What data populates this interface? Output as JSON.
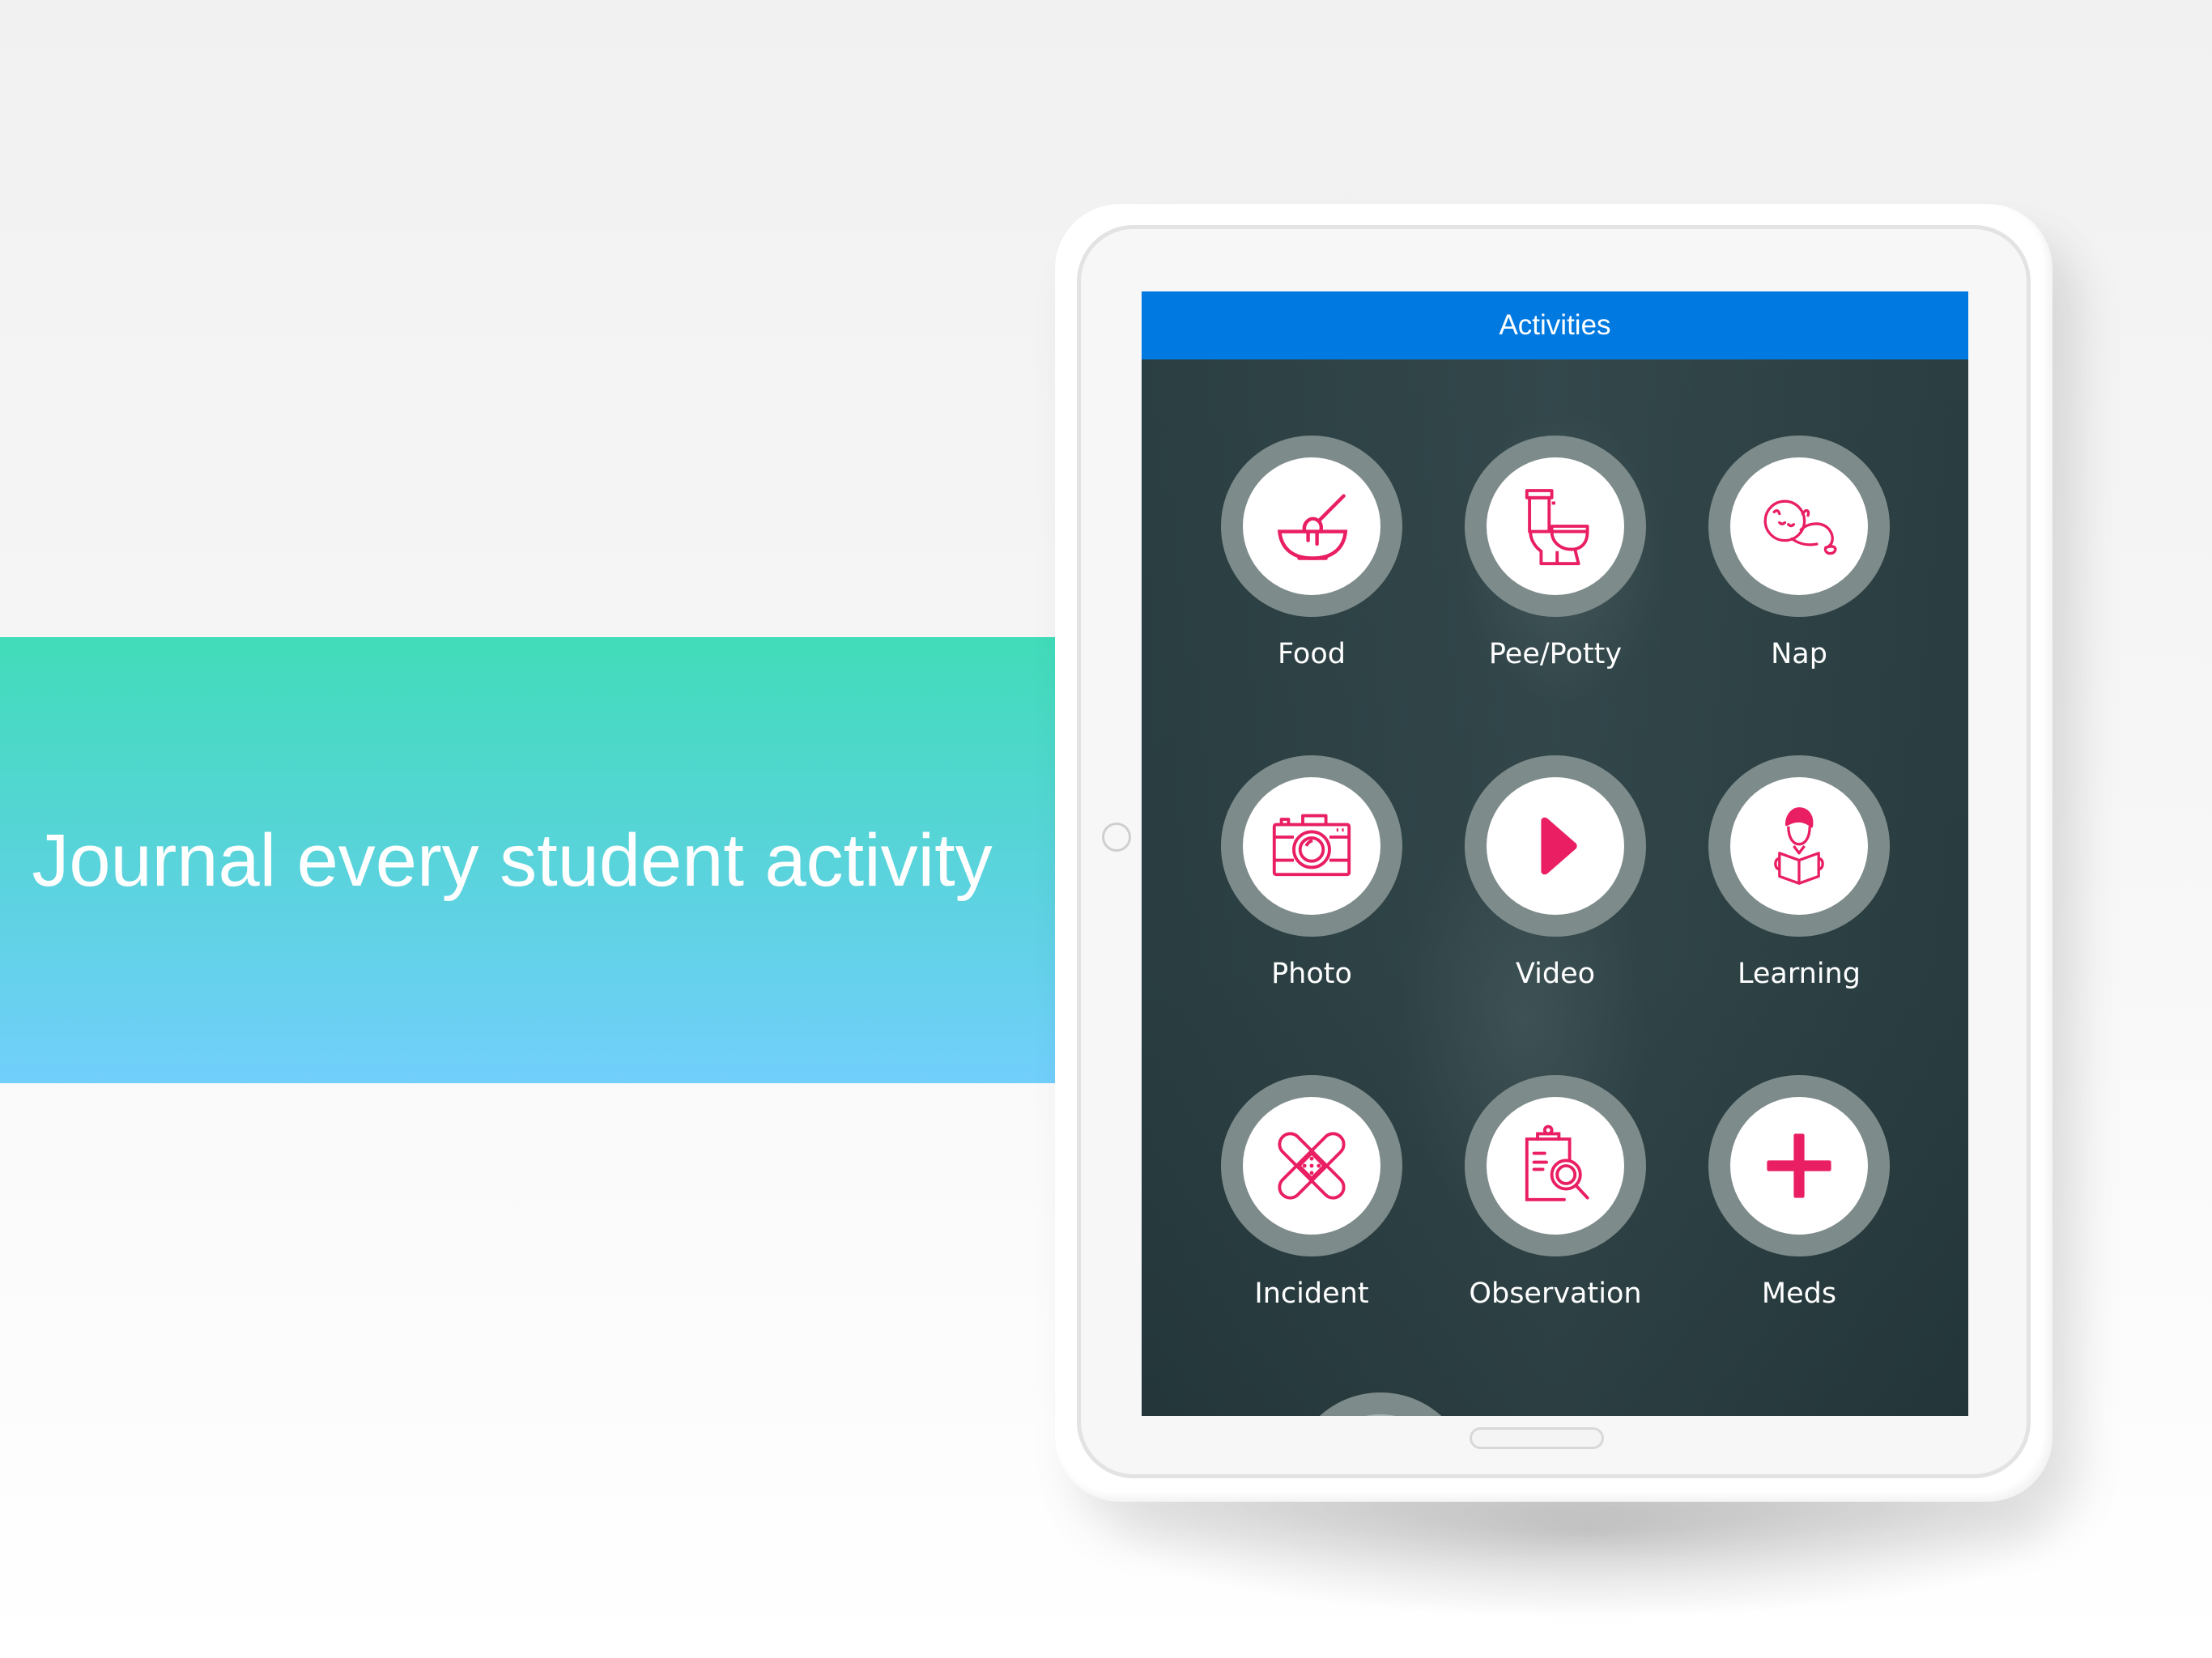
{
  "banner": {
    "headline": "Journal every student activity",
    "gradient_top": "#41dcb9",
    "gradient_bottom": "#72cffc"
  },
  "app": {
    "header_title": "Activities",
    "header_color": "#007ae0",
    "icon_color": "#e91e63",
    "activities": [
      {
        "label": "Food",
        "icon": "bowl-spoon-icon"
      },
      {
        "label": "Pee/Potty",
        "icon": "toilet-icon"
      },
      {
        "label": "Nap",
        "icon": "sleeping-baby-icon"
      },
      {
        "label": "Photo",
        "icon": "camera-icon"
      },
      {
        "label": "Video",
        "icon": "play-icon"
      },
      {
        "label": "Learning",
        "icon": "reading-child-icon"
      },
      {
        "label": "Incident",
        "icon": "bandage-icon"
      },
      {
        "label": "Observation",
        "icon": "clipboard-search-icon"
      },
      {
        "label": "Meds",
        "icon": "medical-plus-icon"
      }
    ]
  }
}
